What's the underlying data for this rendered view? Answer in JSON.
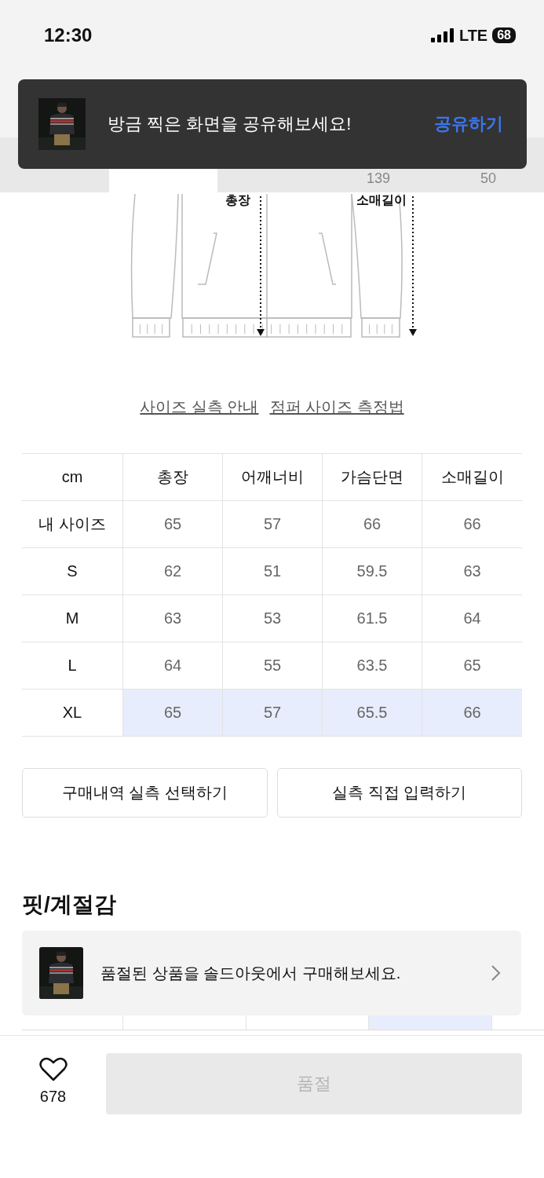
{
  "status_bar": {
    "time": "12:30",
    "network": "LTE",
    "battery": "68"
  },
  "toast": {
    "message": "방금 찍은 화면을 공유해보세요!",
    "action": "공유하기"
  },
  "tab_strip": {
    "values": [
      "139",
      "50"
    ]
  },
  "diagram": {
    "labels": [
      "총장",
      "소매길이"
    ]
  },
  "links": [
    "사이즈 실측 안내",
    "점퍼 사이즈 측정법"
  ],
  "size_table": {
    "columns": [
      "cm",
      "총장",
      "어깨너비",
      "가슴단면",
      "소매길이"
    ],
    "rows": [
      {
        "label": "내 사이즈",
        "values": [
          "65",
          "57",
          "66",
          "66"
        ],
        "selected": false
      },
      {
        "label": "S",
        "values": [
          "62",
          "51",
          "59.5",
          "63"
        ],
        "selected": false
      },
      {
        "label": "M",
        "values": [
          "63",
          "53",
          "61.5",
          "64"
        ],
        "selected": false
      },
      {
        "label": "L",
        "values": [
          "64",
          "55",
          "63.5",
          "65"
        ],
        "selected": false
      },
      {
        "label": "XL",
        "values": [
          "65",
          "57",
          "65.5",
          "66"
        ],
        "selected": true
      }
    ]
  },
  "buttons": [
    "구매내역 실측 선택하기",
    "실측 직접 입력하기"
  ],
  "section_title": "핏/계절감",
  "soldout_banner": {
    "text": "품절된 상품을 솔드아웃에서 구매해보세요."
  },
  "bottom_bar": {
    "likes": "678",
    "button": {
      "label": "품절",
      "disabled": true
    }
  }
}
